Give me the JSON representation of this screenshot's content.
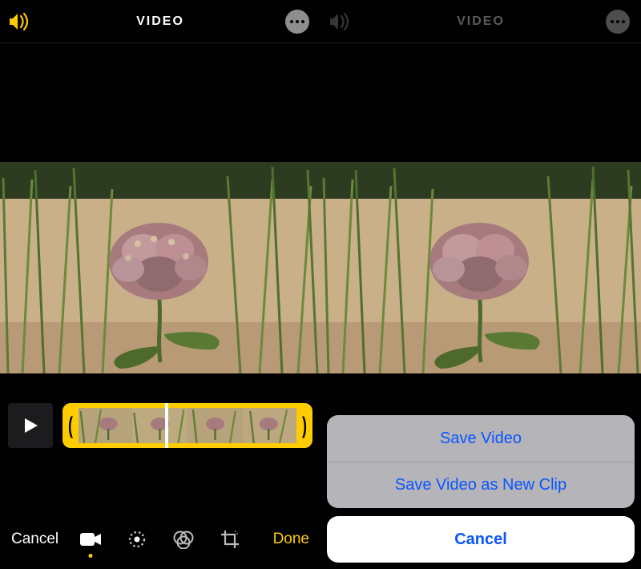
{
  "left": {
    "topbar": {
      "title": "VIDEO"
    },
    "bottom": {
      "cancel_label": "Cancel",
      "done_label": "Done"
    },
    "trim": {
      "left_chevron": "(",
      "right_chevron": ")"
    }
  },
  "right": {
    "topbar": {
      "title": "VIDEO"
    },
    "sheet": {
      "options": [
        "Save Video",
        "Save Video as New Clip"
      ],
      "cancel_label": "Cancel"
    }
  },
  "colors": {
    "accent_yellow": "#ffcc00",
    "ios_blue": "#0a55ff"
  }
}
